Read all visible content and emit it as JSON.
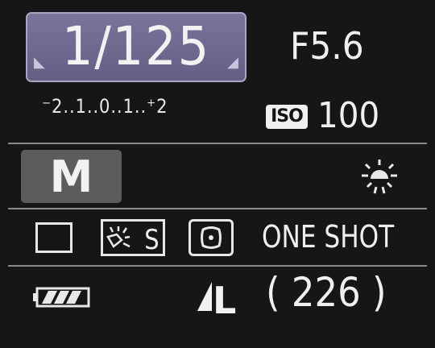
{
  "shutter_speed": "1/125",
  "aperture": "F5.6",
  "exposure_scale": "⁻2..1..0..1..⁺2",
  "iso": {
    "label": "ISO",
    "value": "100"
  },
  "shooting_mode": "M",
  "white_balance_icon": "sun-daylight-icon",
  "drive_mode_icon": "single-shot-icon",
  "picture_style": {
    "label": "S",
    "icon": "picture-style-standard-icon"
  },
  "metering_icon": "evaluative-metering-icon",
  "af_mode": "ONE SHOT",
  "battery_icon": "battery-full-icon",
  "image_quality": "L",
  "shots_remaining": "( 226 )",
  "colors": {
    "shutter_bg": "#6f6890",
    "mode_bg": "#5c5c5c",
    "background": "#161616",
    "text": "#efefef"
  }
}
